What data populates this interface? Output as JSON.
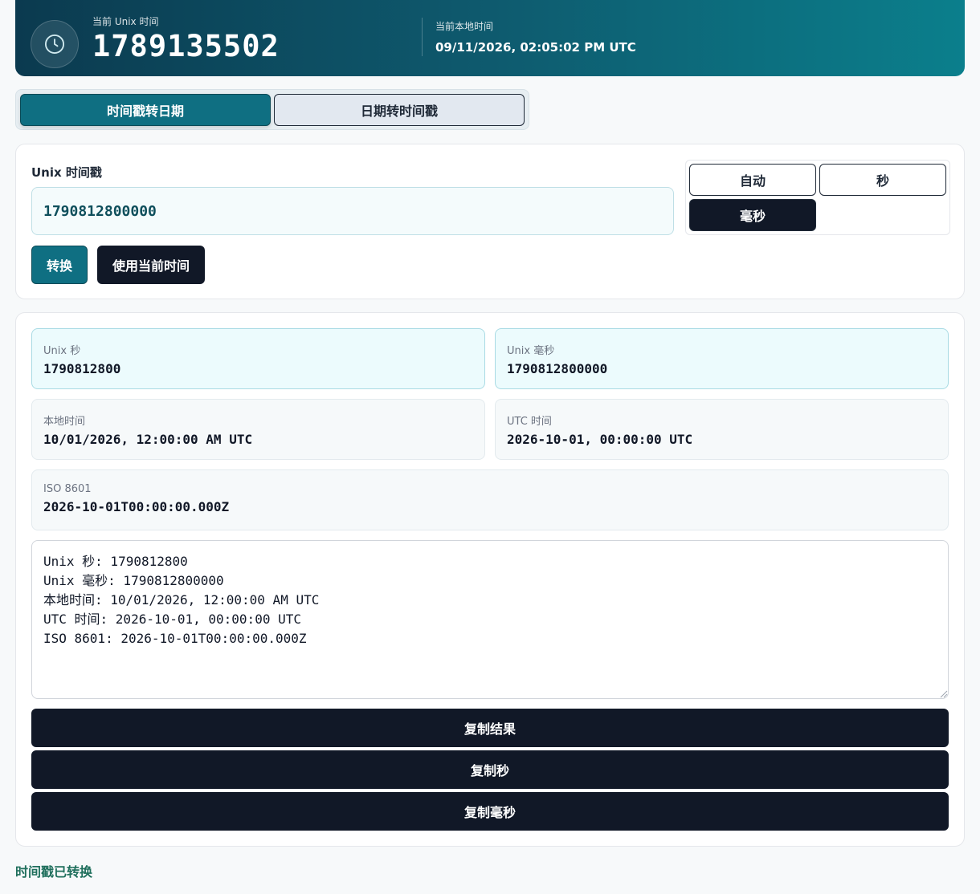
{
  "header": {
    "current_unix_label": "当前 Unix 时间",
    "current_unix_value": "1789135502",
    "current_local_label": "当前本地时间",
    "current_local_value": "09/11/2026, 02:05:02 PM UTC",
    "icon": "clock-icon"
  },
  "tabs": [
    {
      "label": "时间戳转日期",
      "active": true
    },
    {
      "label": "日期转时间戳",
      "active": false
    }
  ],
  "input": {
    "label": "Unix 时间戳",
    "value": "1790812800000",
    "units": [
      {
        "label": "自动",
        "selected": false
      },
      {
        "label": "秒",
        "selected": false
      },
      {
        "label": "毫秒",
        "selected": true
      }
    ],
    "convert_label": "转换",
    "use_now_label": "使用当前时间"
  },
  "results": {
    "unix_seconds": {
      "label": "Unix 秒",
      "value": "1790812800"
    },
    "unix_ms": {
      "label": "Unix 毫秒",
      "value": "1790812800000"
    },
    "local_time": {
      "label": "本地时间",
      "value": "10/01/2026, 12:00:00 AM UTC"
    },
    "utc_time": {
      "label": "UTC 时间",
      "value": "2026-10-01, 00:00:00 UTC"
    },
    "iso": {
      "label": "ISO 8601",
      "value": "2026-10-01T00:00:00.000Z"
    },
    "summary_text": "Unix 秒: 1790812800\nUnix 毫秒: 1790812800000\n本地时间: 10/01/2026, 12:00:00 AM UTC\nUTC 时间: 2026-10-01, 00:00:00 UTC\nISO 8601: 2026-10-01T00:00:00.000Z",
    "copy_result_label": "复制结果",
    "copy_seconds_label": "复制秒",
    "copy_ms_label": "复制毫秒"
  },
  "status": "时间戳已转换",
  "colors": {
    "accent": "#0f6f82",
    "dark": "#111827",
    "header_gradient_start": "#0b3a4f",
    "header_gradient_end": "#0b7f8c",
    "status": "#1f6f5c"
  }
}
